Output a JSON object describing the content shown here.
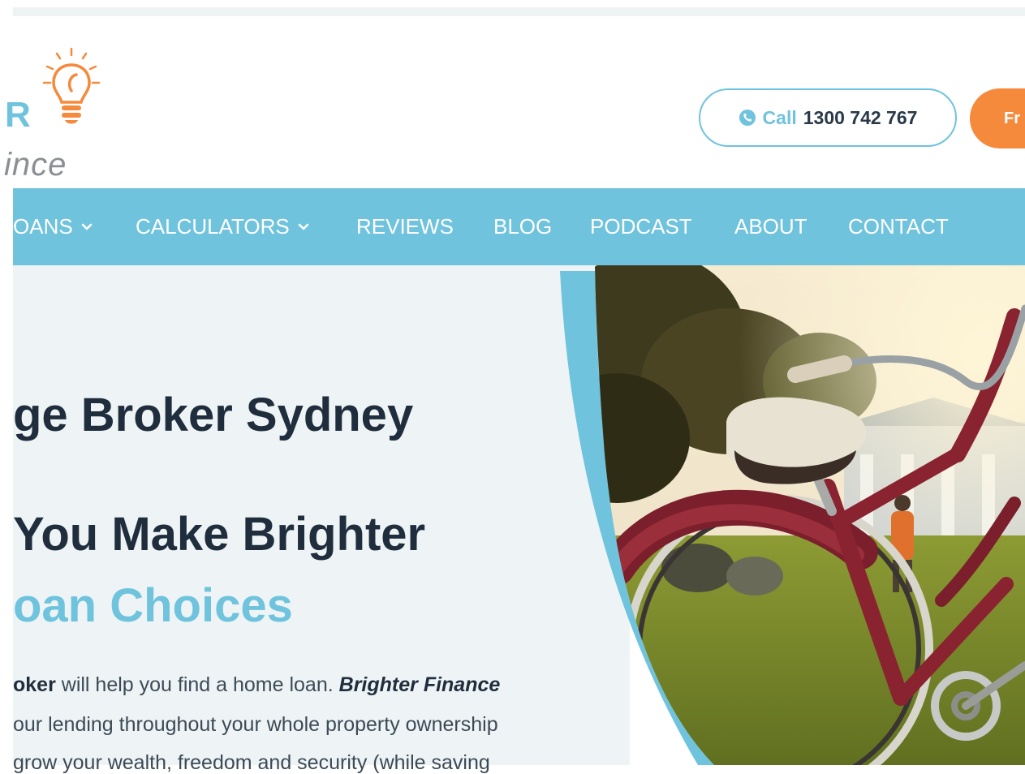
{
  "header": {
    "logo": {
      "letter": "R",
      "word": "ince"
    },
    "call_button": {
      "label": "Call",
      "number": "1300 742 767"
    },
    "free_button": {
      "label": "Fr"
    }
  },
  "nav": {
    "items": [
      {
        "label": "OANS",
        "has_dropdown": true
      },
      {
        "label": "CALCULATORS",
        "has_dropdown": true
      },
      {
        "label": "REVIEWS",
        "has_dropdown": false
      },
      {
        "label": "BLOG",
        "has_dropdown": false
      },
      {
        "label": "PODCAST",
        "has_dropdown": false
      },
      {
        "label": "ABOUT",
        "has_dropdown": false
      },
      {
        "label": "CONTACT",
        "has_dropdown": false
      }
    ]
  },
  "hero": {
    "headline_line1": "ge Broker Sydney",
    "headline_line2": "You Make Brighter",
    "headline_line3": "oan Choices",
    "paragraph": {
      "line1_bold": "oker",
      "line1_text": " will help you find a home loan. ",
      "line1_italic": "Brighter Finance",
      "line2": "our lending throughout your whole property ownership",
      "line3": "grow your wealth, freedom and security (while saving"
    },
    "image_description_icon": "bicycle-photo"
  },
  "colors": {
    "brand_blue": "#6fc3dd",
    "brand_orange": "#f58a3d",
    "heading_dark": "#1f2d3d",
    "hero_bg": "#eef4f5"
  },
  "icons": {
    "logo": "lightbulb-icon",
    "call": "phone-icon",
    "dropdown": "chevron-down-icon"
  }
}
